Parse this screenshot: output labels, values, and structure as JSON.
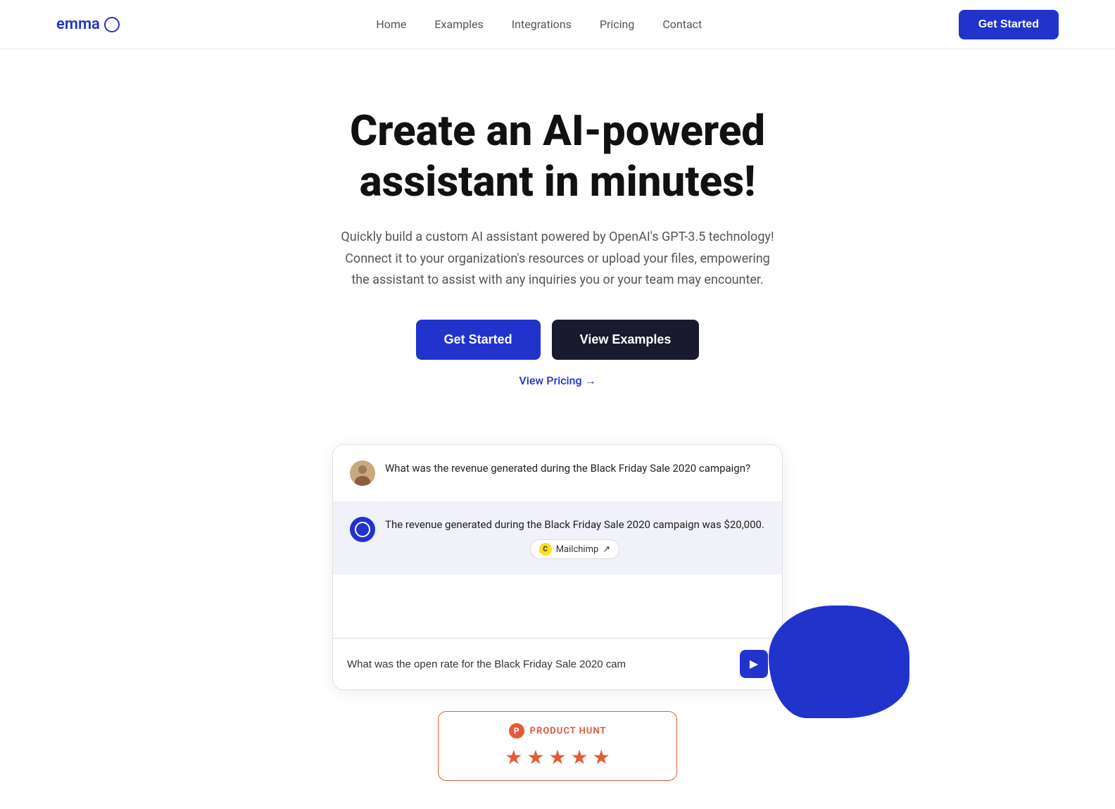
{
  "logo": {
    "text": "emma",
    "icon": "circle-icon"
  },
  "navbar": {
    "links": [
      {
        "label": "Home",
        "href": "#"
      },
      {
        "label": "Examples",
        "href": "#"
      },
      {
        "label": "Integrations",
        "href": "#"
      },
      {
        "label": "Pricing",
        "href": "#"
      },
      {
        "label": "Contact",
        "href": "#"
      }
    ],
    "cta_label": "Get Started"
  },
  "hero": {
    "heading_line1": "Create an AI-powered",
    "heading_line2": "assistant in minutes!",
    "description": "Quickly build a custom AI assistant powered by OpenAI's GPT-3.5 technology! Connect it to your organization's resources or upload your files, empowering the assistant to assist with any inquiries you or your team may encounter.",
    "btn_get_started": "Get Started",
    "btn_view_examples": "View Examples",
    "view_pricing_link": "View Pricing →"
  },
  "chat_demo": {
    "user_question": "What was the revenue generated during the Black Friday Sale 2020 campaign?",
    "assistant_answer": "The revenue generated during the Black Friday Sale 2020 campaign was $20,000.",
    "source_label": "Mailchimp",
    "source_external_icon": "↗",
    "input_placeholder": "What was the open rate for the Black Friday Sale 2020 cam",
    "send_icon": "▶"
  },
  "product_hunt": {
    "badge_label": "PRODUCT HUNT",
    "stars_count": 5
  }
}
